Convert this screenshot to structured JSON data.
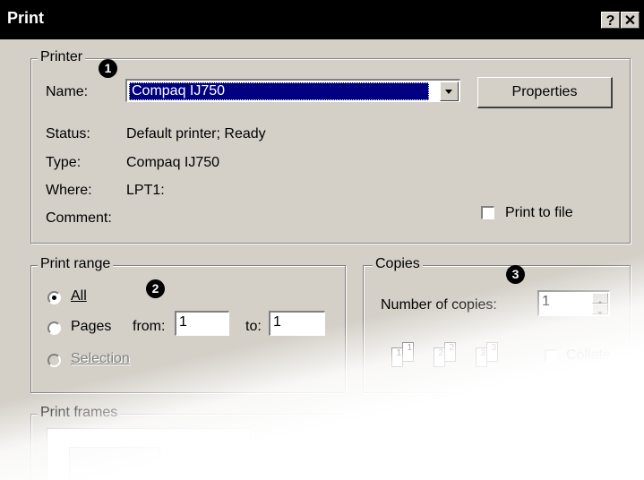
{
  "window": {
    "title": "Print",
    "help_label": "?",
    "close_label": "✕"
  },
  "printer": {
    "legend": "Printer",
    "name_label": "Name:",
    "name_value": "Compaq IJ750",
    "properties_label": "Properties",
    "status_label": "Status:",
    "status_value": "Default printer; Ready",
    "type_label": "Type:",
    "type_value": "Compaq IJ750",
    "where_label": "Where:",
    "where_value": "LPT1:",
    "comment_label": "Comment:",
    "print_to_file_label": "Print to file",
    "print_to_file_checked": false
  },
  "print_range": {
    "legend": "Print range",
    "all_label": "All",
    "pages_label": "Pages",
    "from_label": "from:",
    "from_value": "1",
    "to_label": "to:",
    "to_value": "1",
    "selection_label": "Selection",
    "selected": "All"
  },
  "copies": {
    "legend": "Copies",
    "number_label": "Number of copies:",
    "number_value": "1",
    "collate_label": "Collate",
    "collate_checked": false,
    "page_numbers": [
      "1",
      "1",
      "2",
      "2",
      "3",
      "3"
    ]
  },
  "print_frames": {
    "legend": "Print frames"
  },
  "callouts": [
    "1",
    "2",
    "3"
  ],
  "colors": {
    "titlebar": "#000000",
    "dialog": "#d4d0c8",
    "selection": "#000080"
  }
}
